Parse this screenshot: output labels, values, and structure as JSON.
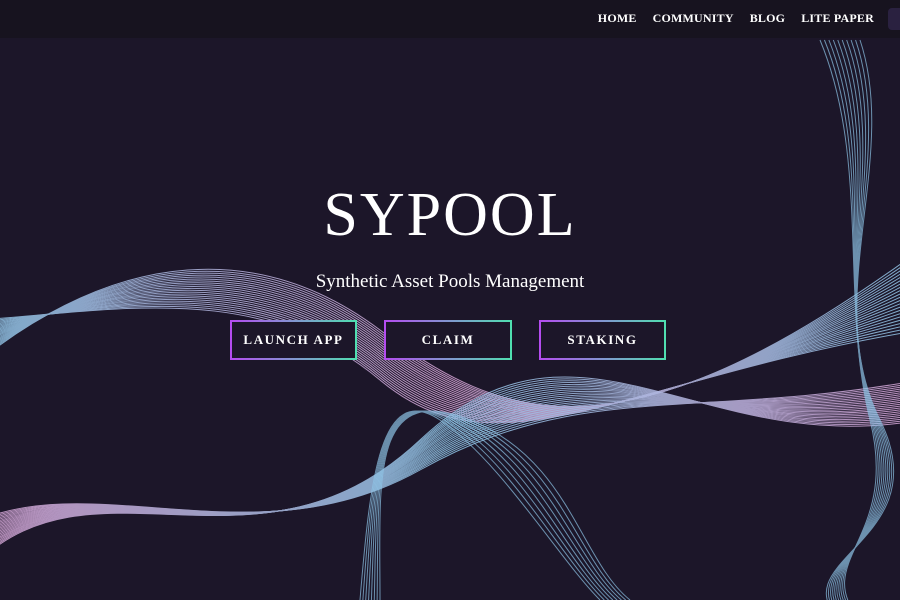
{
  "nav": {
    "items": [
      "HOME",
      "COMMUNITY",
      "BLOG",
      "LITE PAPER"
    ]
  },
  "hero": {
    "title": "SYPOOL",
    "subtitle": "Synthetic Asset Pools Management"
  },
  "actions": {
    "launch_label": "LAUNCH APP",
    "claim_label": "CLAIM",
    "staking_label": "STAKING"
  },
  "colors": {
    "background": "#1c1629",
    "topbar": "#17131f",
    "wave_pink": "#d9a6d8",
    "wave_blue": "#8fc6e8",
    "button_gradient_start": "#b54bf0",
    "button_gradient_end": "#4fe0b0"
  }
}
